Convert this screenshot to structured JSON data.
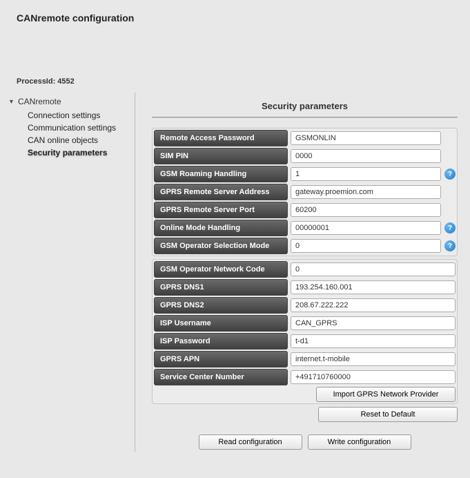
{
  "page_title": "CANremote configuration",
  "process_id_label": "ProcessId: 4552",
  "sidebar": {
    "root": "CANremote",
    "items": [
      {
        "label": "Connection settings"
      },
      {
        "label": "Communication settings"
      },
      {
        "label": "CAN online objects"
      },
      {
        "label": "Security parameters",
        "active": true
      }
    ]
  },
  "section_title": "Security parameters",
  "group1": [
    {
      "label": "Remote Access Password",
      "value": "GSMONLIN",
      "help": false
    },
    {
      "label": "SIM PIN",
      "value": "0000",
      "help": false
    },
    {
      "label": "GSM Roaming Handling",
      "value": "1",
      "help": true
    },
    {
      "label": "GPRS Remote Server Address",
      "value": "gateway.proemion.com",
      "help": false
    },
    {
      "label": "GPRS Remote Server Port",
      "value": "60200",
      "help": false
    },
    {
      "label": "Online Mode Handling",
      "value": "00000001",
      "help": true
    },
    {
      "label": "GSM Operator Selection Mode",
      "value": "0",
      "help": true
    }
  ],
  "group2": [
    {
      "label": "GSM Operator Network Code",
      "value": "0"
    },
    {
      "label": "GPRS DNS1",
      "value": "193.254.160.001"
    },
    {
      "label": "GPRS DNS2",
      "value": "208.67.222.222"
    },
    {
      "label": "ISP Username",
      "value": "CAN_GPRS"
    },
    {
      "label": "ISP Password",
      "value": "t-d1"
    },
    {
      "label": "GPRS APN",
      "value": "internet.t-mobile"
    },
    {
      "label": "Service Center Number",
      "value": "+491710760000"
    }
  ],
  "buttons": {
    "import": "Import GPRS Network Provider",
    "reset": "Reset to Default",
    "read": "Read configuration",
    "write": "Write configuration"
  }
}
